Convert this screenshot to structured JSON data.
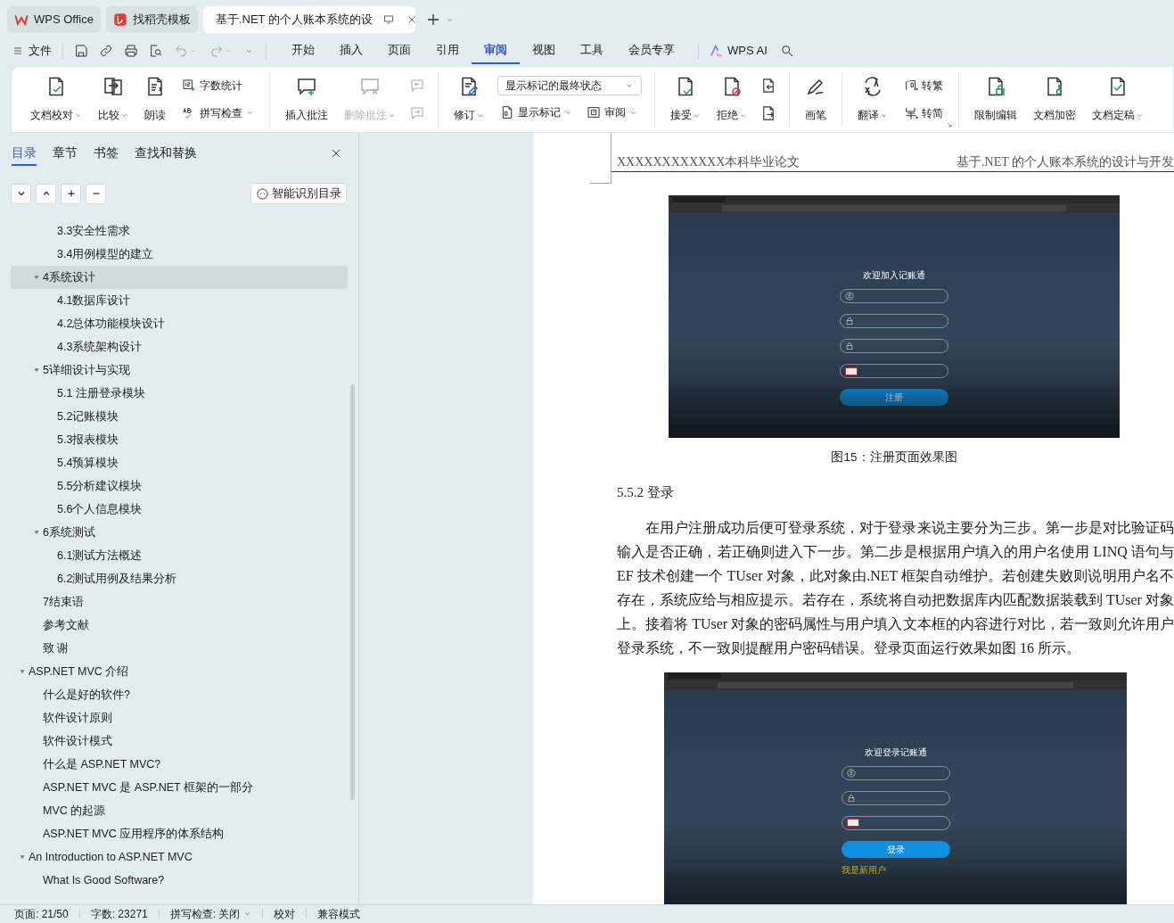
{
  "window_tabs": [
    {
      "label": "WPS Office",
      "selected": false,
      "kind": "wps"
    },
    {
      "label": "找稻壳模板",
      "selected": false,
      "kind": "template"
    },
    {
      "label": "基于.NET 的个人账本系统的设",
      "selected": true,
      "kind": "doc"
    }
  ],
  "menu": {
    "file": "文件",
    "tabs": [
      {
        "label": "开始",
        "selected": false
      },
      {
        "label": "插入",
        "selected": false
      },
      {
        "label": "页面",
        "selected": false
      },
      {
        "label": "引用",
        "selected": false
      },
      {
        "label": "审阅",
        "selected": true
      },
      {
        "label": "视图",
        "selected": false
      },
      {
        "label": "工具",
        "selected": false
      },
      {
        "label": "会员专享",
        "selected": false
      }
    ],
    "ai": "WPS AI"
  },
  "ribbon": {
    "groups": [
      {
        "items": [
          {
            "kind": "large",
            "label": "文档校对",
            "dropdown": true,
            "disabled": false
          },
          {
            "kind": "large",
            "label": "比较",
            "dropdown": true,
            "disabled": false
          },
          {
            "kind": "large",
            "label": "朗读",
            "dropdown": false,
            "disabled": false
          },
          {
            "kind": "stack",
            "items": [
              {
                "kind": "small",
                "label": "字数统计",
                "dropdown": false,
                "disabled": false
              },
              {
                "kind": "small",
                "label": "拼写检查",
                "dropdown": true,
                "disabled": false
              }
            ]
          }
        ]
      },
      {
        "items": [
          {
            "kind": "large",
            "label": "插入批注",
            "dropdown": false,
            "disabled": false
          },
          {
            "kind": "large",
            "label": "删除批注",
            "dropdown": true,
            "disabled": true
          },
          {
            "kind": "stack",
            "items": [
              {
                "kind": "icon",
                "disabled": true
              },
              {
                "kind": "icon",
                "disabled": true
              }
            ]
          }
        ]
      },
      {
        "items": [
          {
            "kind": "large",
            "label": "修订",
            "dropdown": true,
            "disabled": false
          },
          {
            "kind": "stack",
            "items": [
              {
                "kind": "select",
                "value": "显示标记的最终状态"
              },
              {
                "kind": "row",
                "items": [
                  {
                    "kind": "small",
                    "label": "显示标记",
                    "dropdown": true,
                    "disabled": false
                  },
                  {
                    "kind": "small",
                    "label": "审阅",
                    "dropdown": true,
                    "disabled": false
                  }
                ]
              }
            ]
          }
        ]
      },
      {
        "items": [
          {
            "kind": "large",
            "label": "接受",
            "dropdown": true,
            "disabled": false
          },
          {
            "kind": "large",
            "label": "拒绝",
            "dropdown": true,
            "disabled": false
          },
          {
            "kind": "stack",
            "items": [
              {
                "kind": "icon",
                "disabled": false
              },
              {
                "kind": "icon",
                "disabled": false
              }
            ]
          }
        ]
      },
      {
        "items": [
          {
            "kind": "large",
            "label": "画笔",
            "dropdown": false,
            "disabled": false
          }
        ]
      },
      {
        "items": [
          {
            "kind": "large",
            "label": "翻译",
            "dropdown": true,
            "disabled": false
          },
          {
            "kind": "stack",
            "items": [
              {
                "kind": "small",
                "label": "转繁",
                "dropdown": false,
                "disabled": false
              },
              {
                "kind": "small",
                "label": "转简",
                "dropdown": false,
                "disabled": false
              }
            ]
          }
        ],
        "launcher": true
      },
      {
        "items": [
          {
            "kind": "large",
            "label": "限制编辑",
            "dropdown": false,
            "disabled": false
          },
          {
            "kind": "large",
            "label": "文档加密",
            "dropdown": false,
            "disabled": false
          },
          {
            "kind": "large",
            "label": "文档定稿",
            "dropdown": true,
            "disabled": false
          }
        ]
      }
    ]
  },
  "sidebar": {
    "tabs": [
      {
        "label": "目录",
        "selected": true
      },
      {
        "label": "章节",
        "selected": false
      },
      {
        "label": "书签",
        "selected": false
      },
      {
        "label": "查找和替换",
        "selected": false
      }
    ],
    "smart_button": "智能识别目录",
    "toc": [
      {
        "children": [
          {
            "children": [
              {
                "label": "3.3安全性需求",
                "selected": false
              },
              {
                "label": "3.4用例模型的建立",
                "selected": false
              }
            ]
          },
          {
            "label": "4系统设计",
            "selected": true,
            "expanded": true,
            "children": [
              {
                "label": "4.1数据库设计",
                "selected": false
              },
              {
                "label": "4.2总体功能模块设计",
                "selected": false
              },
              {
                "label": "4.3系统架构设计",
                "selected": false
              }
            ]
          },
          {
            "label": "5详细设计与实现",
            "selected": false,
            "expanded": true,
            "children": [
              {
                "label": "5.1 注册登录模块",
                "selected": false
              },
              {
                "label": "5.2记账模块",
                "selected": false
              },
              {
                "label": "5.3报表模块",
                "selected": false
              },
              {
                "label": "5.4预算模块",
                "selected": false
              },
              {
                "label": "5.5分析建议模块",
                "selected": false
              },
              {
                "label": "5.6个人信息模块",
                "selected": false
              }
            ]
          },
          {
            "label": "6系统测试",
            "selected": false,
            "expanded": true,
            "children": [
              {
                "label": "6.1测试方法概述",
                "selected": false
              },
              {
                "label": "6.2测试用例及结果分析",
                "selected": false
              }
            ]
          },
          {
            "label": "7结束语",
            "selected": false
          },
          {
            "label": "参考文献",
            "selected": false
          },
          {
            "label": "致 谢",
            "selected": false
          }
        ]
      },
      {
        "label": "ASP.NET MVC 介绍",
        "selected": false,
        "expanded": true,
        "children": [
          {
            "label": "什么是好的软件?",
            "selected": false
          },
          {
            "label": "软件设计原则",
            "selected": false
          },
          {
            "label": "软件设计模式",
            "selected": false
          },
          {
            "label": "什么是 ASP.NET MVC?",
            "selected": false
          },
          {
            "label": "ASP.NET MVC 是 ASP.NET 框架的一部分",
            "selected": false
          },
          {
            "label": "MVC 的起源",
            "selected": false
          },
          {
            "label": "ASP.NET MVC 应用程序的体系结构",
            "selected": false
          }
        ]
      },
      {
        "label": "An Introduction to ASP.NET MVC",
        "selected": false,
        "expanded": true,
        "children": [
          {
            "label": "What Is Good Software?",
            "selected": false
          }
        ]
      }
    ]
  },
  "document": {
    "header_left": "XXXXXXXXXXXX本科毕业论文",
    "header_right": "基于.NET 的个人账本系统的设计与开发",
    "blocks": [
      {
        "kind": "figure",
        "title": "欢迎加入记账通",
        "fields": [
          {
            "kind": "user"
          },
          {
            "kind": "lock"
          },
          {
            "kind": "lock"
          },
          {
            "kind": "captcha"
          }
        ],
        "button": "注册"
      },
      {
        "kind": "caption",
        "text": "图15：注册页面效果图"
      },
      {
        "kind": "heading",
        "text": "5.5.2 登录"
      },
      {
        "kind": "paragraph",
        "text": "在用户注册成功后便可登录系统，对于登录来说主要分为三步。第一步是对比验证码输入是否正确，若正确则进入下一步。第二步是根据用户填入的用户名使用 LINQ 语句与 EF 技术创建一个 TUser 对象，此对象由.NET 框架自动维护。若创建失败则说明用户名不存在，系统应给与相应提示。若存在，系统将自动把数据库内匹配数据装载到 TUser 对象上。接着将 TUser 对象的密码属性与用户填入文本框的内容进行对比，若一致则允许用户登录系统，不一致则提醒用户密码错误。登录页面运行效果如图 16 所示。"
      },
      {
        "kind": "figure",
        "title": "欢迎登录记账通",
        "fields": [
          {
            "kind": "user"
          },
          {
            "kind": "lock"
          },
          {
            "kind": "captcha"
          }
        ],
        "button": "登录",
        "link": "我是新用户"
      }
    ]
  },
  "status_bar": [
    {
      "label": "页面: 21/50",
      "dropdown": false
    },
    {
      "label": "字数: 23271",
      "dropdown": false
    },
    {
      "label": "拼写检查: 关闭",
      "dropdown": true
    },
    {
      "label": "校对",
      "dropdown": false
    },
    {
      "label": "兼容模式",
      "dropdown": false
    }
  ]
}
